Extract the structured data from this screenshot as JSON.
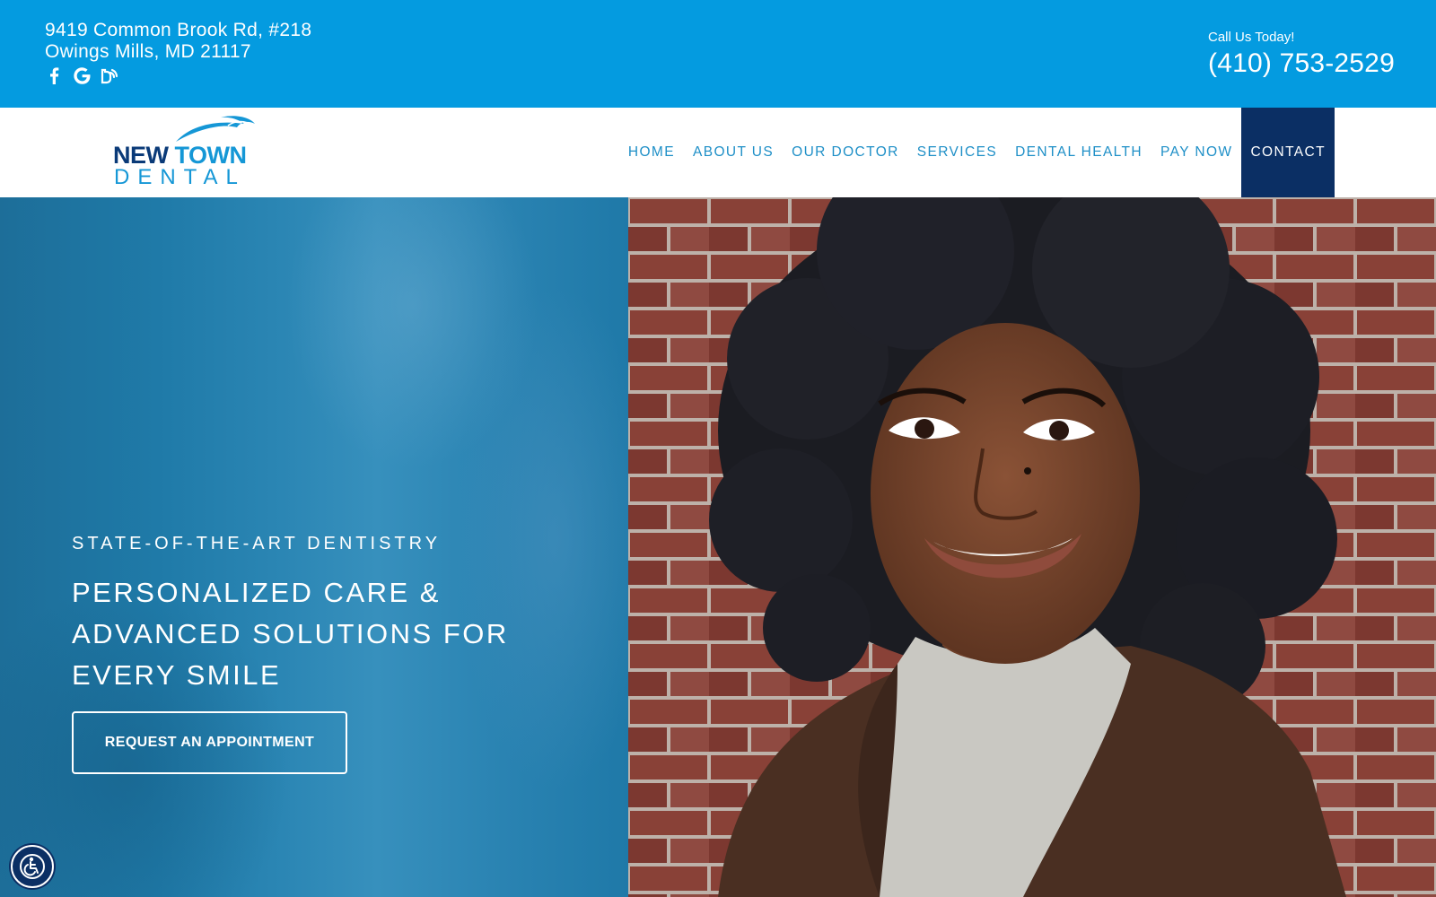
{
  "topbar": {
    "address_line1": "9419 Common Brook Rd, #218",
    "address_line2": "Owings Mills, MD 21117",
    "socials": [
      "facebook-icon",
      "google-icon",
      "review-icon"
    ],
    "call_label": "Call Us Today!",
    "phone": "(410) 753-2529",
    "background_color": "#049be0"
  },
  "logo": {
    "word1": "NEW",
    "word2": "TOWN",
    "word3": "DENTAL"
  },
  "nav": {
    "items": [
      {
        "label": "HOME"
      },
      {
        "label": "ABOUT US"
      },
      {
        "label": "OUR DOCTOR"
      },
      {
        "label": "SERVICES"
      },
      {
        "label": "DENTAL HEALTH"
      },
      {
        "label": "PAY NOW"
      },
      {
        "label": "CONTACT"
      }
    ],
    "active": "CONTACT",
    "active_color": "#0b2f64",
    "text_color": "#1e8fc7"
  },
  "hero": {
    "eyebrow": "STATE-OF-THE-ART DENTISTRY",
    "headline_lines": [
      "PERSONALIZED CARE &",
      "ADVANCED SOLUTIONS FOR",
      "EVERY SMILE"
    ],
    "cta_label": "REQUEST AN APPOINTMENT",
    "image": "smiling woman with curly hair in front of brick wall"
  },
  "accessibility": {
    "icon": "accessibility-icon"
  }
}
